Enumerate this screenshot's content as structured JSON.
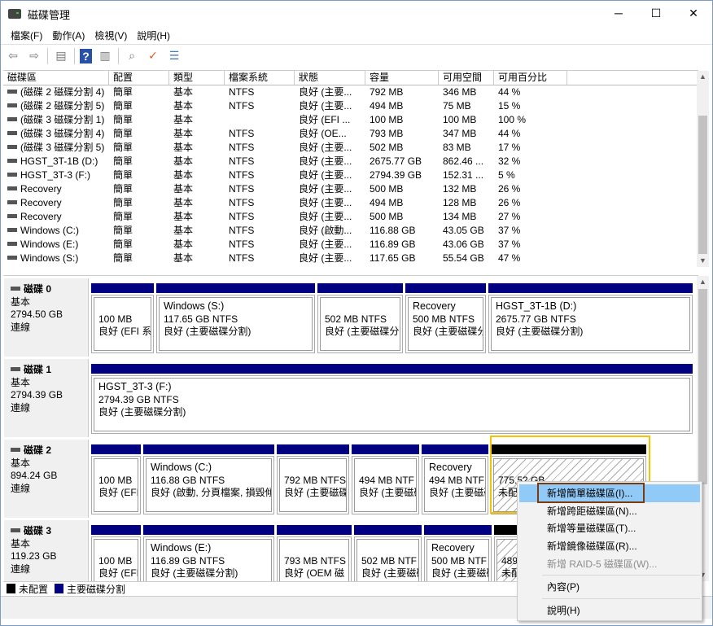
{
  "window": {
    "title": "磁碟管理",
    "minimize": "─",
    "maximize": "☐",
    "close": "✕"
  },
  "menubar": [
    "檔案(F)",
    "動作(A)",
    "檢視(V)",
    "說明(H)"
  ],
  "toolbar": [
    "back-icon",
    "forward-icon",
    "show-hide-console-tree-icon",
    "help-icon",
    "show-hide-action-pane-icon",
    "connect-disk-icon",
    "check-icon",
    "properties-list-icon"
  ],
  "volume_table": {
    "columns": [
      "磁碟區",
      "配置",
      "類型",
      "檔案系統",
      "狀態",
      "容量",
      "可用空間",
      "可用百分比"
    ],
    "rows": [
      [
        "(磁碟 2 磁碟分割 4)",
        "簡單",
        "基本",
        "NTFS",
        "良好 (主要...",
        "792 MB",
        "346 MB",
        "44 %"
      ],
      [
        "(磁碟 2 磁碟分割 5)",
        "簡單",
        "基本",
        "NTFS",
        "良好 (主要...",
        "494 MB",
        "75 MB",
        "15 %"
      ],
      [
        "(磁碟 3 磁碟分割 1)",
        "簡單",
        "基本",
        "",
        "良好 (EFI ...",
        "100 MB",
        "100 MB",
        "100 %"
      ],
      [
        "(磁碟 3 磁碟分割 4)",
        "簡單",
        "基本",
        "NTFS",
        "良好 (OE...",
        "793 MB",
        "347 MB",
        "44 %"
      ],
      [
        "(磁碟 3 磁碟分割 5)",
        "簡單",
        "基本",
        "NTFS",
        "良好 (主要...",
        "502 MB",
        "83 MB",
        "17 %"
      ],
      [
        "HGST_3T-1B (D:)",
        "簡單",
        "基本",
        "NTFS",
        "良好 (主要...",
        "2675.77 GB",
        "862.46 ...",
        "32 %"
      ],
      [
        "HGST_3T-3 (F:)",
        "簡單",
        "基本",
        "NTFS",
        "良好 (主要...",
        "2794.39 GB",
        "152.31 ...",
        "5 %"
      ],
      [
        "Recovery",
        "簡單",
        "基本",
        "NTFS",
        "良好 (主要...",
        "500 MB",
        "132 MB",
        "26 %"
      ],
      [
        "Recovery",
        "簡單",
        "基本",
        "NTFS",
        "良好 (主要...",
        "494 MB",
        "128 MB",
        "26 %"
      ],
      [
        "Recovery",
        "簡單",
        "基本",
        "NTFS",
        "良好 (主要...",
        "500 MB",
        "134 MB",
        "27 %"
      ],
      [
        "Windows (C:)",
        "簡單",
        "基本",
        "NTFS",
        "良好 (啟動...",
        "116.88 GB",
        "43.05 GB",
        "37 %"
      ],
      [
        "Windows (E:)",
        "簡單",
        "基本",
        "NTFS",
        "良好 (主要...",
        "116.89 GB",
        "43.06 GB",
        "37 %"
      ],
      [
        "Windows (S:)",
        "簡單",
        "基本",
        "NTFS",
        "良好 (主要...",
        "117.65 GB",
        "55.54 GB",
        "47 %"
      ]
    ]
  },
  "disks": [
    {
      "name": "磁碟 0",
      "type": "基本",
      "size": "2794.50 GB",
      "status": "連線",
      "partitions": [
        {
          "kind": "primary",
          "lines": [
            "",
            "100 MB",
            "良好 (EFI 系"
          ]
        },
        {
          "kind": "primary",
          "lines": [
            "Windows  (S:)",
            "117.65 GB NTFS",
            "良好 (主要磁碟分割)"
          ]
        },
        {
          "kind": "primary",
          "lines": [
            "",
            "502 MB NTFS",
            "良好 (主要磁碟分"
          ]
        },
        {
          "kind": "primary",
          "lines": [
            "Recovery",
            "500 MB NTFS",
            "良好 (主要磁碟分"
          ]
        },
        {
          "kind": "primary",
          "lines": [
            "HGST_3T-1B  (D:)",
            "2675.77 GB NTFS",
            "良好 (主要磁碟分割)"
          ]
        }
      ]
    },
    {
      "name": "磁碟 1",
      "type": "基本",
      "size": "2794.39 GB",
      "status": "連線",
      "partitions": [
        {
          "kind": "primary",
          "lines": [
            "HGST_3T-3  (F:)",
            "2794.39 GB NTFS",
            "良好 (主要磁碟分割)"
          ]
        }
      ]
    },
    {
      "name": "磁碟 2",
      "type": "基本",
      "size": "894.24 GB",
      "status": "連線",
      "partitions": [
        {
          "kind": "primary",
          "lines": [
            "",
            "100 MB",
            "良好 (EFI"
          ]
        },
        {
          "kind": "primary",
          "lines": [
            "Windows  (C:)",
            "116.88 GB NTFS",
            "良好 (啟動, 分頁檔案, 損毀傾"
          ]
        },
        {
          "kind": "primary",
          "lines": [
            "",
            "792 MB NTFS",
            "良好 (主要磁碟"
          ]
        },
        {
          "kind": "primary",
          "lines": [
            "",
            "494 MB NTF",
            "良好 (主要磁碟"
          ]
        },
        {
          "kind": "primary",
          "lines": [
            "Recovery",
            "494 MB NTF",
            "良好 (主要磁碟"
          ]
        },
        {
          "kind": "unallocated",
          "lines": [
            "",
            "775.52 GB",
            "未配置"
          ]
        }
      ]
    },
    {
      "name": "磁碟 3",
      "type": "基本",
      "size": "119.23 GB",
      "status": "連線",
      "partitions": [
        {
          "kind": "primary",
          "lines": [
            "",
            "100 MB",
            "良好 (EFI"
          ]
        },
        {
          "kind": "primary",
          "lines": [
            "Windows  (E:)",
            "116.89 GB NTFS",
            "良好 (主要磁碟分割)"
          ]
        },
        {
          "kind": "primary",
          "lines": [
            "",
            "793 MB NTFS",
            "良好 (OEM 磁"
          ]
        },
        {
          "kind": "primary",
          "lines": [
            "",
            "502 MB NTF",
            "良好 (主要磁碟"
          ]
        },
        {
          "kind": "primary",
          "lines": [
            "Recovery",
            "500 MB NTF",
            "良好 (主要磁碟"
          ]
        },
        {
          "kind": "unallocated",
          "lines": [
            "",
            "489",
            "未配置"
          ]
        }
      ]
    }
  ],
  "legend": [
    {
      "label": "未配置",
      "color": "#000000"
    },
    {
      "label": "主要磁碟分割",
      "color": "#000080"
    }
  ],
  "context_menu": {
    "items": [
      {
        "label": "新增簡單磁碟區(I)...",
        "highlighted": true,
        "enabled": true
      },
      {
        "label": "新增跨距磁碟區(N)...",
        "enabled": true
      },
      {
        "label": "新增等量磁碟區(T)...",
        "enabled": true
      },
      {
        "label": "新增鏡像磁碟區(R)...",
        "enabled": true
      },
      {
        "label": "新增 RAID-5 磁碟區(W)...",
        "enabled": false
      },
      {
        "label": "內容(P)",
        "enabled": true
      },
      {
        "label": "說明(H)",
        "enabled": true
      }
    ]
  },
  "colors": {
    "primary": "#000080",
    "unallocated": "#000000",
    "highlight": "#91c9f7",
    "annotation_yellow": "#f5c400",
    "annotation_brown": "#7a3b10"
  }
}
